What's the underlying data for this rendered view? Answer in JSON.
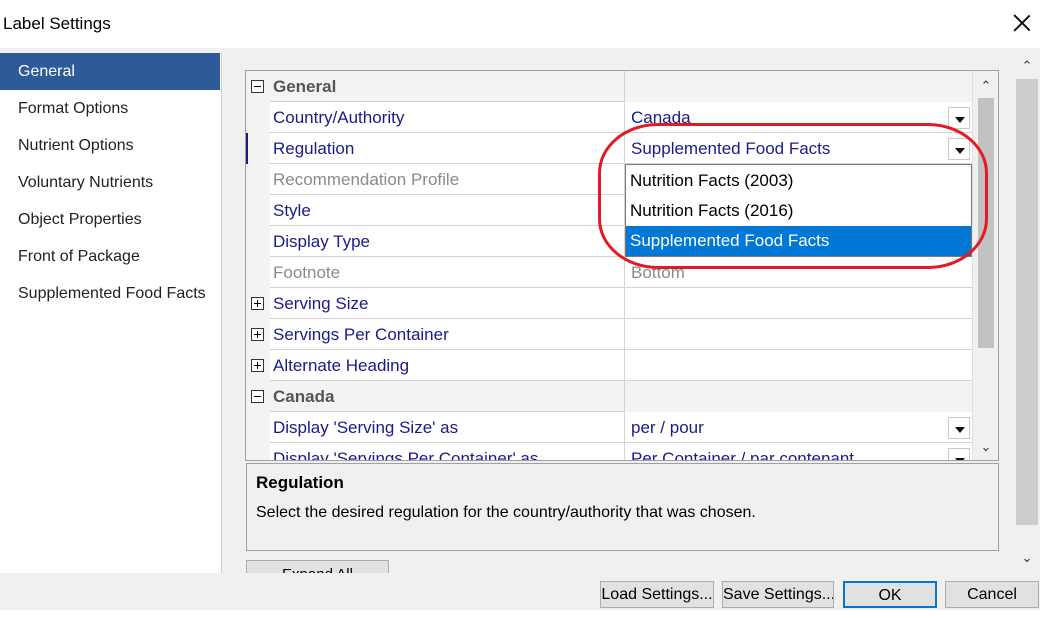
{
  "window": {
    "title": "Label Settings"
  },
  "sidebar": {
    "items": [
      {
        "label": "General"
      },
      {
        "label": "Format Options"
      },
      {
        "label": "Nutrient Options"
      },
      {
        "label": "Voluntary Nutrients"
      },
      {
        "label": "Object Properties"
      },
      {
        "label": "Front of Package"
      },
      {
        "label": "Supplemented Food Facts"
      }
    ],
    "selected": "General"
  },
  "grid": {
    "rows": [
      {
        "kind": "category",
        "expander": "minus",
        "name": "General",
        "value": ""
      },
      {
        "kind": "property",
        "name": "Country/Authority",
        "value": "Canada",
        "dropdown": true
      },
      {
        "kind": "property",
        "name": "Regulation",
        "value": "Supplemented Food Facts",
        "dropdown": true,
        "selected": true
      },
      {
        "kind": "disabled",
        "name": "Recommendation Profile",
        "value": ""
      },
      {
        "kind": "property",
        "name": "Style",
        "value": ""
      },
      {
        "kind": "property",
        "name": "Display Type",
        "value": ""
      },
      {
        "kind": "disabled",
        "name": "Footnote",
        "value": "Bottom"
      },
      {
        "kind": "property",
        "expander": "plus",
        "name": "Serving Size",
        "value": ""
      },
      {
        "kind": "property",
        "expander": "plus",
        "name": "Servings Per Container",
        "value": ""
      },
      {
        "kind": "property",
        "expander": "plus",
        "name": "Alternate Heading",
        "value": ""
      },
      {
        "kind": "category",
        "expander": "minus",
        "name": "Canada",
        "value": ""
      },
      {
        "kind": "property",
        "name": "Display 'Serving Size' as",
        "value": "per / pour",
        "dropdown": true
      },
      {
        "kind": "property",
        "name": "Display 'Servings Per Container' as",
        "value": "Per Container / par contenant",
        "dropdown": true
      }
    ]
  },
  "regulation_dropdown": {
    "options": [
      {
        "label": "Nutrition Facts (2003)"
      },
      {
        "label": "Nutrition Facts (2016)"
      },
      {
        "label": "Supplemented Food Facts",
        "selected": true
      }
    ]
  },
  "help": {
    "title": "Regulation",
    "description": "Select the desired regulation for the country/authority that was chosen."
  },
  "buttons": {
    "expand_all": "Expand All",
    "load_settings": "Load Settings...",
    "save_settings": "Save Settings...",
    "ok": "OK",
    "cancel": "Cancel"
  },
  "colors": {
    "sidebar_selected": "#2e5a99",
    "dropdown_selected": "#0078d7",
    "property_text": "#1a1a8c",
    "annotation_circle": "#e01b24"
  }
}
